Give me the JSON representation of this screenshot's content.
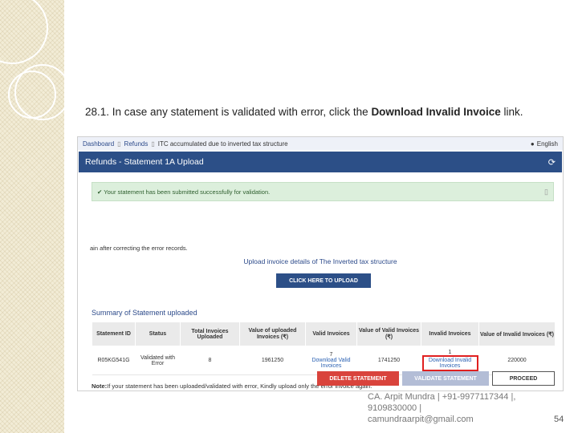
{
  "heading": {
    "prefix": "28.1. In case any statement is validated with error, click the ",
    "bold": "Download Invalid Invoice",
    "suffix": " link."
  },
  "breadcrumb": {
    "items": [
      "Dashboard",
      "Refunds",
      "ITC accumulated due to inverted tax structure"
    ],
    "language": "English"
  },
  "page_title": "Refunds - Statement 1A Upload",
  "alert": "Your statement has been submitted successfully for validation.",
  "cut_text": "ain after correcting the error records.",
  "upload": {
    "label": "Upload invoice details of The Inverted tax structure",
    "button": "CLICK HERE TO UPLOAD"
  },
  "summary_title": "Summary of Statement uploaded",
  "table": {
    "headers": [
      "Statement ID",
      "Status",
      "Total Invoices Uploaded",
      "Value of uploaded Invoices (₹)",
      "Valid Invoices",
      "Value of Valid Invoices (₹)",
      "Invalid Invoices",
      "Value of Invalid Invoices (₹)"
    ],
    "row": {
      "id": "R05KG541G",
      "status": "Validated with Error",
      "total": "8",
      "value_uploaded": "1961250",
      "valid_count": "7",
      "valid_link": "Download Valid Invoices",
      "valid_value": "1741250",
      "invalid_count": "1",
      "invalid_link": "Download Invalid Invoices",
      "invalid_value": "220000"
    }
  },
  "note": {
    "bold": "Note:",
    "text": "If your statement has been uploaded/validated with error, Kindly upload only the error invoice again."
  },
  "buttons": {
    "delete": "DELETE STATEMENT",
    "validate": "VALIDATE STATEMENT",
    "proceed": "PROCEED"
  },
  "footer": {
    "line1": "CA. Arpit Mundra | +91-9977117344 |,",
    "line2": "9109830000 |",
    "line3": "camundraarpit@gmail.com"
  },
  "page_number": "54"
}
